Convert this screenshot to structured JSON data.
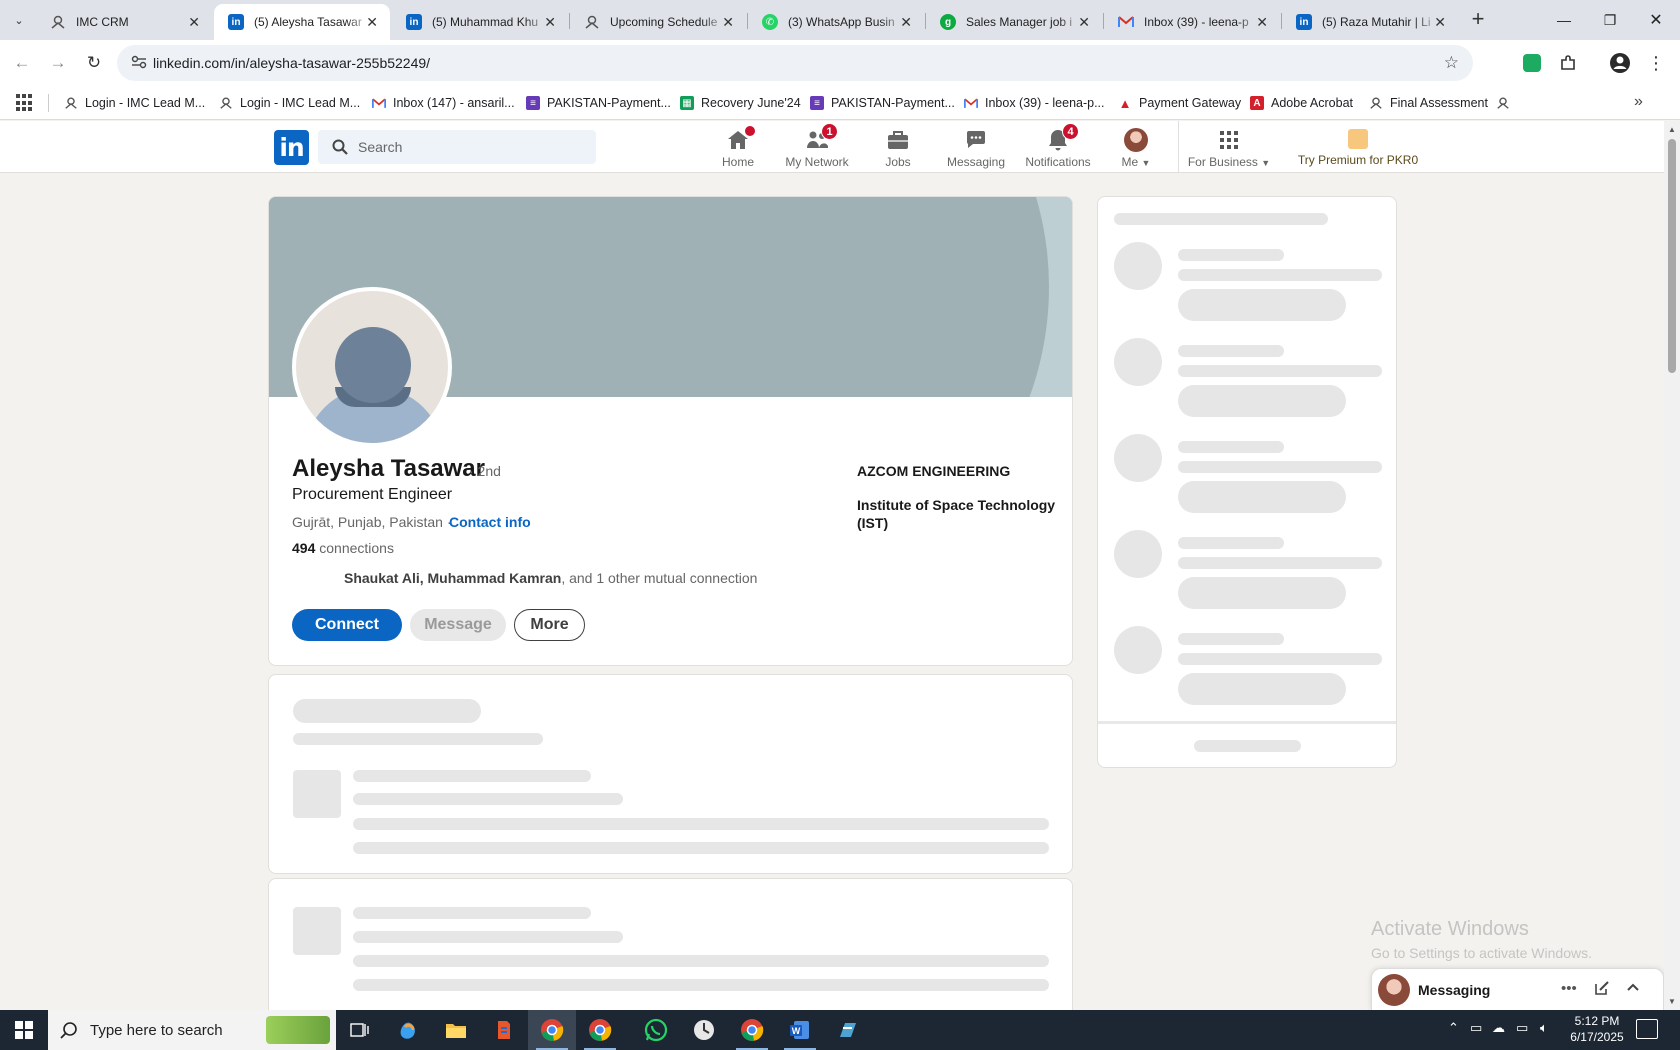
{
  "browser": {
    "tabs": [
      {
        "title": "IMC CRM",
        "favicon": "imc-icon",
        "active": false
      },
      {
        "title": "(5) Aleysha Tasawar",
        "favicon": "linkedin-icon",
        "active": true
      },
      {
        "title": "(5) Muhammad Khu",
        "favicon": "linkedin-icon",
        "active": false
      },
      {
        "title": "Upcoming Schedule",
        "favicon": "imc-icon",
        "active": false
      },
      {
        "title": "(3) WhatsApp Busin",
        "favicon": "whatsapp-icon",
        "active": false
      },
      {
        "title": "Sales Manager job i",
        "favicon": "glassdoor-icon",
        "active": false
      },
      {
        "title": "Inbox (39) - leena-p",
        "favicon": "gmail-icon",
        "active": false
      },
      {
        "title": "(5) Raza Mutahir | Li",
        "favicon": "linkedin-icon",
        "active": false
      }
    ],
    "url": "linkedin.com/in/aleysha-tasawar-255b52249/",
    "bookmarks": [
      {
        "label": "Login - IMC Lead M...",
        "icon": "imc-icon"
      },
      {
        "label": "Login - IMC Lead M...",
        "icon": "imc-icon"
      },
      {
        "label": "Inbox (147) - ansaril...",
        "icon": "gmail-icon"
      },
      {
        "label": "PAKISTAN-Payment...",
        "icon": "form-icon"
      },
      {
        "label": "Recovery June'24",
        "icon": "sheets-icon"
      },
      {
        "label": "PAKISTAN-Payment...",
        "icon": "form-icon"
      },
      {
        "label": "Inbox (39) - leena-p...",
        "icon": "gmail-icon"
      },
      {
        "label": "Payment Gateway",
        "icon": "acrobat-icon"
      },
      {
        "label": "Adobe Acrobat",
        "icon": "acrobat-icon"
      },
      {
        "label": "Final Assessment",
        "icon": "imc-icon"
      }
    ]
  },
  "linkedin": {
    "search_placeholder": "Search",
    "nav": {
      "home": "Home",
      "network": "My Network",
      "network_badge": "1",
      "jobs": "Jobs",
      "messaging": "Messaging",
      "notifications": "Notifications",
      "notifications_badge": "4",
      "me": "Me",
      "for_business": "For Business",
      "premium": "Try Premium for PKR0"
    },
    "profile": {
      "name": "Aleysha Tasawar",
      "degree": "· 2nd",
      "headline": "Procurement Engineer",
      "location": "Gujrāt, Punjab, Pakistan ·",
      "contact_info": "Contact info",
      "connections_count": "494",
      "connections_label": "connections",
      "mutual_names": "Shaukat Ali, Muhammad Kamran",
      "mutual_rest": ", and 1 other mutual connection",
      "company": "AZCOM ENGINEERING",
      "school": "Institute of Space Technology (IST)",
      "connect_label": "Connect",
      "message_label": "Message",
      "more_label": "More"
    },
    "messaging_bar": {
      "label": "Messaging"
    }
  },
  "windows": {
    "activate_title": "Activate Windows",
    "activate_sub": "Go to Settings to activate Windows.",
    "search_placeholder": "Type here to search",
    "time": "5:12 PM",
    "date": "6/17/2025"
  },
  "colors": {
    "linkedin_blue": "#0a66c2",
    "badge_red": "#cb112d",
    "page_bg": "#f4f2ee"
  }
}
